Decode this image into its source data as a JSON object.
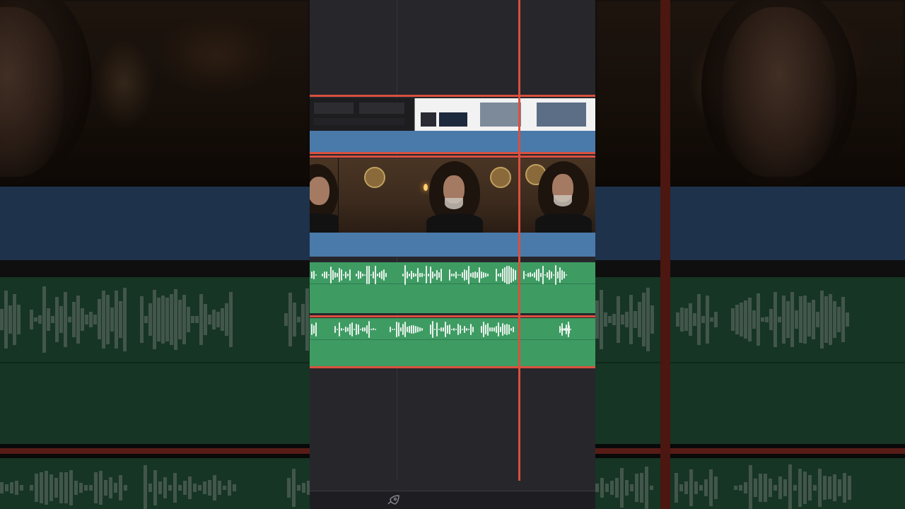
{
  "app": {
    "view": "timeline"
  },
  "colors": {
    "panel_bg": "#26262b",
    "playhead": "#d9503f",
    "video_track_bar": "#4a7aa9",
    "audio_track": "#3e9c63",
    "waveform": "#e9f3ec"
  },
  "tracks": [
    {
      "type": "video",
      "content": "screen-recording-clip",
      "selected": true
    },
    {
      "type": "video",
      "content": "talking-head-clip",
      "selected": true
    },
    {
      "type": "audio",
      "content": "audio-clip-1",
      "selected": false
    },
    {
      "type": "audio",
      "content": "audio-clip-2",
      "selected": true
    }
  ],
  "toolbar": {
    "icons": [
      "rocket-icon"
    ]
  }
}
